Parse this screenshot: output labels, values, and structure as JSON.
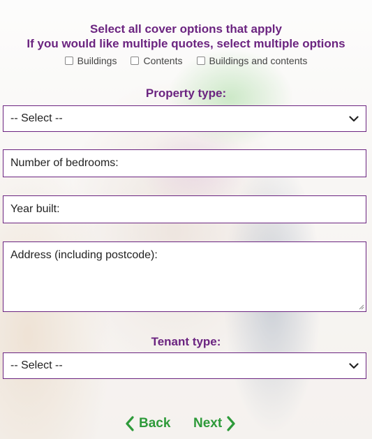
{
  "header": {
    "line1": "Select all cover options that apply",
    "line2": "If you would like multiple quotes, select multiple options"
  },
  "cover_options": [
    {
      "label": "Buildings",
      "checked": false
    },
    {
      "label": "Contents",
      "checked": false
    },
    {
      "label": "Buildings and contents",
      "checked": false
    }
  ],
  "property_type": {
    "label": "Property type:",
    "selected": "-- Select --"
  },
  "bedrooms": {
    "placeholder": "Number of bedrooms:"
  },
  "year_built": {
    "placeholder": "Year built:"
  },
  "address": {
    "placeholder": "Address (including postcode):"
  },
  "tenant_type": {
    "label": "Tenant type:",
    "selected": "-- Select --"
  },
  "navigation": {
    "back_label": "Back",
    "next_label": "Next"
  },
  "colors": {
    "heading": "#6b2480",
    "nav": "#2e9a3a",
    "field_border": "#6b2480"
  },
  "icons": {
    "select_arrow": "chevron-down-icon",
    "back": "chevron-left-icon",
    "next": "chevron-right-icon"
  }
}
